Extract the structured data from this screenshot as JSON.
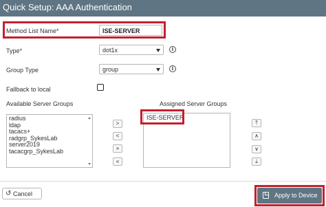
{
  "title": "Quick Setup: AAA Authentication",
  "form": {
    "method_list_label": "Method List Name*",
    "method_list_value": "ISE-SERVER",
    "type_label": "Type*",
    "type_value": "dot1x",
    "group_type_label": "Group Type",
    "group_type_value": "group",
    "fallback_label": "Fallback to local",
    "fallback_checked": false
  },
  "available": {
    "header": "Available Server Groups",
    "items": [
      "radius",
      "ldap",
      "tacacs+",
      "radgrp_SykesLab",
      "server2019",
      "tacacgrp_SykesLab"
    ]
  },
  "assigned": {
    "header": "Assigned Server Groups",
    "items": [
      "ISE-SERVER"
    ]
  },
  "move_buttons": [
    ">",
    "<",
    "»",
    "«"
  ],
  "order_buttons": [
    "⤒",
    "∧",
    "∨",
    "⤓"
  ],
  "footer": {
    "cancel_label": "Cancel",
    "cancel_icon": "↺",
    "apply_label": "Apply to Device"
  },
  "colors": {
    "titlebar": "#5f7583",
    "highlight": "#c3202e",
    "apply_button": "#5f7583"
  }
}
